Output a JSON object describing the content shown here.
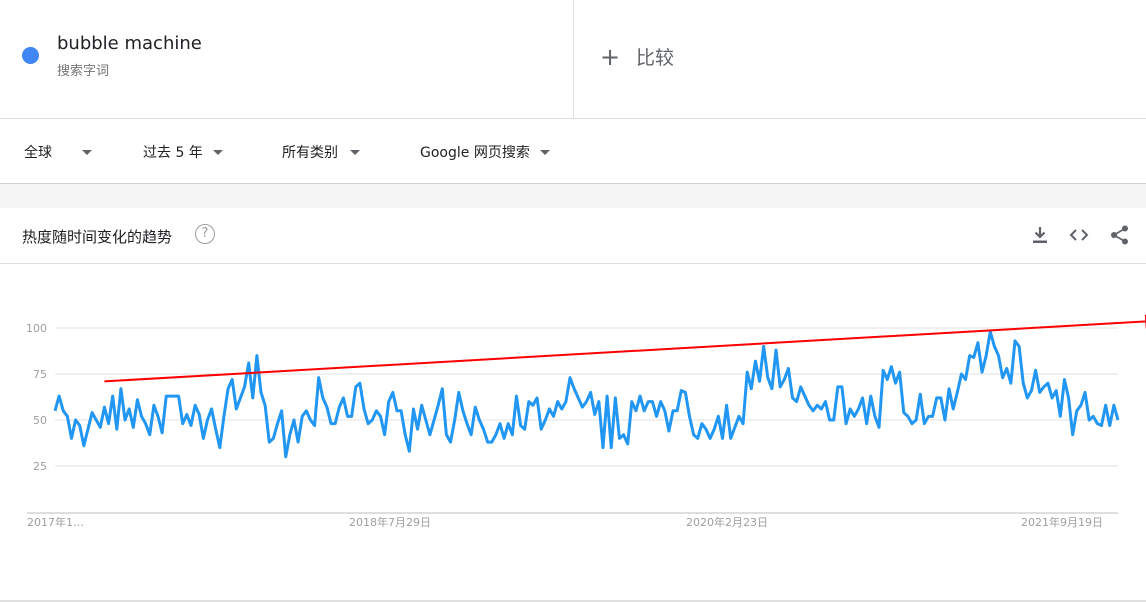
{
  "term": {
    "name": "bubble machine",
    "subtitle": "搜索字词",
    "color": "#4285f4"
  },
  "compare": {
    "label": "比较"
  },
  "filters": [
    {
      "label": "全球"
    },
    {
      "label": "过去 5 年"
    },
    {
      "label": "所有类别"
    },
    {
      "label": "Google 网页搜索"
    }
  ],
  "card": {
    "title": "热度随时间变化的趋势",
    "icons": [
      "help-icon",
      "download-icon",
      "embed-icon",
      "share-icon"
    ]
  },
  "chart_data": {
    "type": "line",
    "title": "",
    "xlabel": "",
    "ylabel": "",
    "ylim": [
      0,
      100
    ],
    "yticks": [
      25,
      50,
      75,
      100
    ],
    "x_tick_labels": [
      "2017年1…",
      "2018年7月29日",
      "2020年2月23日",
      "2021年9月19日"
    ],
    "grid": true,
    "colors": {
      "line": "#2196f3",
      "arrow": "#ff0000",
      "grid": "#e0e0e0",
      "tick": "#9e9e9e"
    },
    "series": [
      {
        "values": [
          55,
          63,
          55,
          52,
          40,
          50,
          47,
          36,
          45,
          54,
          50,
          46,
          57,
          48,
          63,
          45,
          67,
          50,
          56,
          46,
          61,
          52,
          48,
          42,
          58,
          52,
          43,
          63,
          63,
          63,
          63,
          48,
          53,
          47,
          58,
          53,
          40,
          50,
          56,
          45,
          35,
          52,
          67,
          72,
          56,
          62,
          68,
          81,
          62,
          85,
          65,
          58,
          38,
          40,
          48,
          55,
          30,
          42,
          50,
          38,
          52,
          55,
          50,
          47,
          73,
          62,
          57,
          48,
          48,
          57,
          62,
          52,
          52,
          68,
          70,
          56,
          48,
          50,
          55,
          52,
          42,
          60,
          65,
          55,
          55,
          42,
          33,
          56,
          45,
          58,
          50,
          42,
          50,
          58,
          67,
          42,
          38,
          50,
          65,
          55,
          48,
          42,
          57,
          50,
          45,
          38,
          38,
          42,
          48,
          40,
          48,
          42,
          63,
          47,
          45,
          60,
          58,
          62,
          45,
          50,
          56,
          52,
          60,
          56,
          60,
          73,
          67,
          62,
          57,
          60,
          65,
          53,
          60,
          35,
          63,
          35,
          62,
          40,
          42,
          37,
          60,
          55,
          63,
          55,
          60,
          60,
          52,
          60,
          55,
          44,
          55,
          55,
          66,
          65,
          52,
          42,
          40,
          48,
          45,
          40,
          45,
          52,
          40,
          58,
          40,
          46,
          52,
          48,
          76,
          67,
          82,
          71,
          90,
          73,
          67,
          88,
          68,
          72,
          78,
          62,
          60,
          68,
          63,
          58,
          55,
          58,
          56,
          60,
          50,
          50,
          68,
          68,
          48,
          56,
          52,
          56,
          62,
          48,
          63,
          52,
          46,
          77,
          72,
          79,
          70,
          76,
          54,
          52,
          48,
          50,
          64,
          48,
          52,
          52,
          62,
          62,
          50,
          67,
          56,
          65,
          75,
          72,
          85,
          84,
          92,
          76,
          85,
          98,
          90,
          85,
          73,
          78,
          70,
          93,
          90,
          70,
          62,
          66,
          77,
          65,
          68,
          70,
          62,
          66,
          52,
          72,
          62,
          42,
          55,
          58,
          65,
          50,
          52,
          48,
          47,
          58,
          47,
          58,
          50
        ]
      }
    ],
    "annotation": {
      "type": "arrow",
      "from": [
        12,
        71
      ],
      "to": [
        268,
        104
      ]
    }
  }
}
